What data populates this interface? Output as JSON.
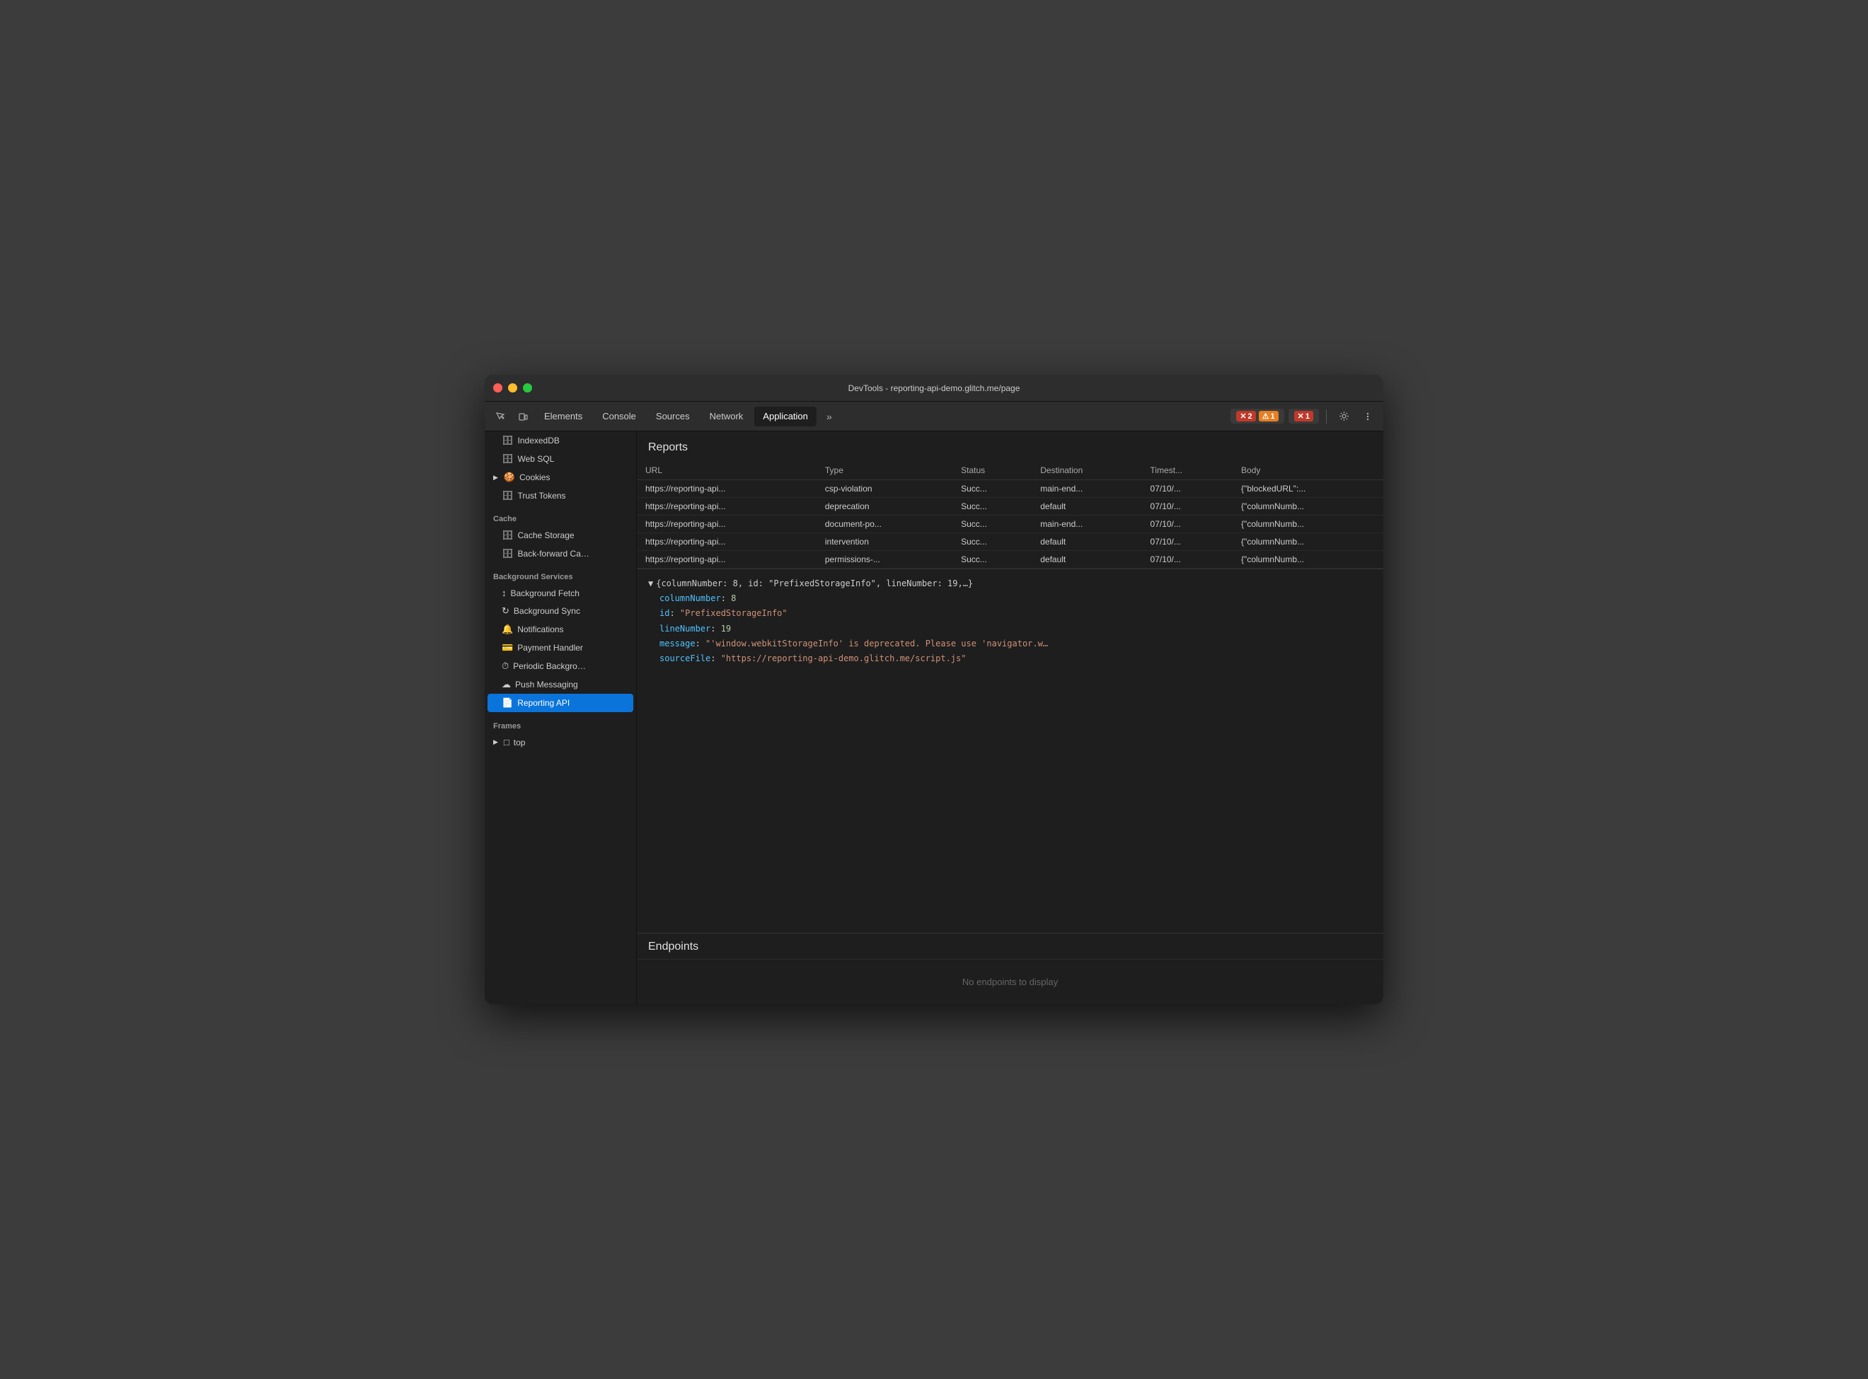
{
  "window": {
    "title": "DevTools - reporting-api-demo.glitch.me/page"
  },
  "toolbar": {
    "tabs": [
      {
        "id": "elements",
        "label": "Elements",
        "active": false
      },
      {
        "id": "console",
        "label": "Console",
        "active": false
      },
      {
        "id": "sources",
        "label": "Sources",
        "active": false
      },
      {
        "id": "network",
        "label": "Network",
        "active": false
      },
      {
        "id": "application",
        "label": "Application",
        "active": true
      }
    ],
    "more_tabs": "»",
    "error_count": "2",
    "warn_count": "1",
    "issue_count": "1",
    "error_icon": "✕",
    "warn_icon": "⚠",
    "issue_icon": "✕"
  },
  "sidebar": {
    "items": [
      {
        "id": "indexeddb",
        "icon": "🗄",
        "label": "IndexedDB"
      },
      {
        "id": "web-sql",
        "icon": "🗄",
        "label": "Web SQL"
      },
      {
        "id": "cookies",
        "icon": "🍪",
        "label": "Cookies",
        "expandable": true
      },
      {
        "id": "trust-tokens",
        "icon": "🗄",
        "label": "Trust Tokens"
      },
      {
        "id": "cache-header",
        "label": "Cache",
        "header": true
      },
      {
        "id": "cache-storage",
        "icon": "🗄",
        "label": "Cache Storage"
      },
      {
        "id": "back-forward",
        "icon": "🗄",
        "label": "Back-forward Ca…"
      },
      {
        "id": "bg-services-header",
        "label": "Background Services",
        "header": true
      },
      {
        "id": "bg-fetch",
        "icon": "↕",
        "label": "Background Fetch"
      },
      {
        "id": "bg-sync",
        "icon": "↻",
        "label": "Background Sync"
      },
      {
        "id": "notifications",
        "icon": "🔔",
        "label": "Notifications"
      },
      {
        "id": "payment-handler",
        "icon": "💳",
        "label": "Payment Handler"
      },
      {
        "id": "periodic-bg",
        "icon": "⏱",
        "label": "Periodic Backgro…"
      },
      {
        "id": "push-messaging",
        "icon": "☁",
        "label": "Push Messaging"
      },
      {
        "id": "reporting-api",
        "icon": "📄",
        "label": "Reporting API",
        "active": true
      },
      {
        "id": "frames-header",
        "label": "Frames",
        "header": true
      },
      {
        "id": "frames-top",
        "icon": "□",
        "label": "top",
        "expandable": true
      }
    ]
  },
  "reports": {
    "section_title": "Reports",
    "columns": [
      "URL",
      "Type",
      "Status",
      "Destination",
      "Timest...",
      "Body"
    ],
    "rows": [
      {
        "url": "https://reporting-api...",
        "type": "csp-violation",
        "status": "Succ...",
        "destination": "main-end...",
        "timestamp": "07/10/...",
        "body": "{\"blockedURL\":..."
      },
      {
        "url": "https://reporting-api...",
        "type": "deprecation",
        "status": "Succ...",
        "destination": "default",
        "timestamp": "07/10/...",
        "body": "{\"columnNumb..."
      },
      {
        "url": "https://reporting-api...",
        "type": "document-po...",
        "status": "Succ...",
        "destination": "main-end...",
        "timestamp": "07/10/...",
        "body": "{\"columnNumb..."
      },
      {
        "url": "https://reporting-api...",
        "type": "intervention",
        "status": "Succ...",
        "destination": "default",
        "timestamp": "07/10/...",
        "body": "{\"columnNumb..."
      },
      {
        "url": "https://reporting-api...",
        "type": "permissions-...",
        "status": "Succ...",
        "destination": "default",
        "timestamp": "07/10/...",
        "body": "{\"columnNumb..."
      }
    ]
  },
  "json_detail": {
    "collapsed_line": "{columnNumber: 8, id: \"PrefixedStorageInfo\", lineNumber: 19,…}",
    "fields": [
      {
        "key": "columnNumber",
        "value": "8",
        "type": "number"
      },
      {
        "key": "id",
        "value": "\"PrefixedStorageInfo\"",
        "type": "string"
      },
      {
        "key": "lineNumber",
        "value": "19",
        "type": "number"
      },
      {
        "key": "message",
        "value": "\"'window.webkitStorageInfo' is deprecated. Please use 'navigator.w…",
        "type": "string"
      },
      {
        "key": "sourceFile",
        "value": "\"https://reporting-api-demo.glitch.me/script.js\"",
        "type": "string"
      }
    ]
  },
  "endpoints": {
    "section_title": "Endpoints",
    "empty_message": "No endpoints to display"
  }
}
